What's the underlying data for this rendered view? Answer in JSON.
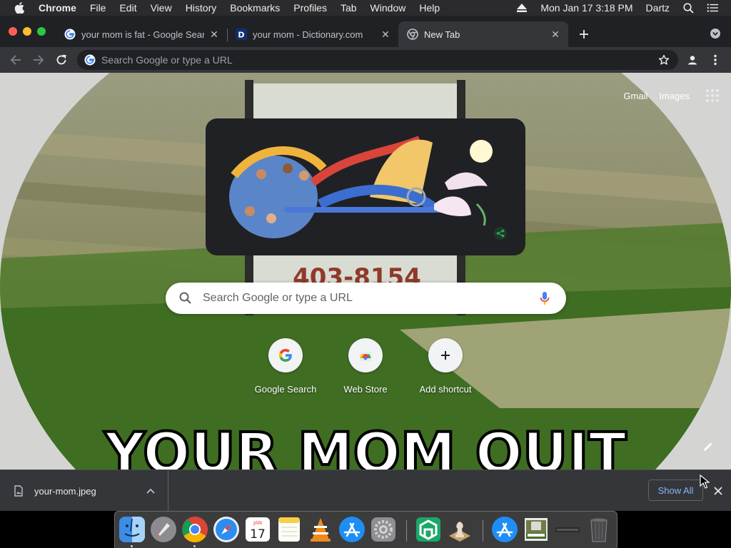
{
  "menubar": {
    "app_name": "Chrome",
    "items": [
      "File",
      "Edit",
      "View",
      "History",
      "Bookmarks",
      "Profiles",
      "Tab",
      "Window",
      "Help"
    ],
    "datetime": "Mon Jan 17  3:18 PM",
    "user": "Dartz"
  },
  "tabs": [
    {
      "title": "your mom is fat - Google Search",
      "favicon": "google-g-icon",
      "active": false
    },
    {
      "title": "your mom - Dictionary.com",
      "favicon": "dictionary-icon",
      "active": false
    },
    {
      "title": "New Tab",
      "favicon": "chrome-icon",
      "active": true
    }
  ],
  "toolbar": {
    "omnibox_placeholder": "Search Google or type a URL"
  },
  "ntp": {
    "links": {
      "gmail": "Gmail",
      "images": "Images"
    },
    "search_placeholder": "Search Google or type a URL",
    "background_caption": "YOUR MOM QUIT",
    "sign_text": "403-8154",
    "shortcuts": [
      {
        "label": "Google Search",
        "icon": "google-g-icon"
      },
      {
        "label": "Web Store",
        "icon": "web-store-icon"
      },
      {
        "label": "Add shortcut",
        "icon": "plus-icon"
      }
    ]
  },
  "downloads": {
    "filename": "your-mom.jpeg",
    "show_all": "Show All"
  },
  "dock": {
    "apps": [
      "Finder",
      "Launchpad",
      "Google Chrome",
      "Safari",
      "Calendar",
      "Notes",
      "VLC",
      "App Store",
      "System Preferences",
      "Sketch",
      "Chess",
      "Downloads",
      "Image",
      "Screenshot",
      "Trash"
    ],
    "calendar_month": "JAN",
    "calendar_day": "17"
  },
  "colors": {
    "menubar": "#2b2b2d",
    "tabstrip": "#202124",
    "toolbar": "#35363a",
    "link_blue": "#8ab4f8"
  }
}
